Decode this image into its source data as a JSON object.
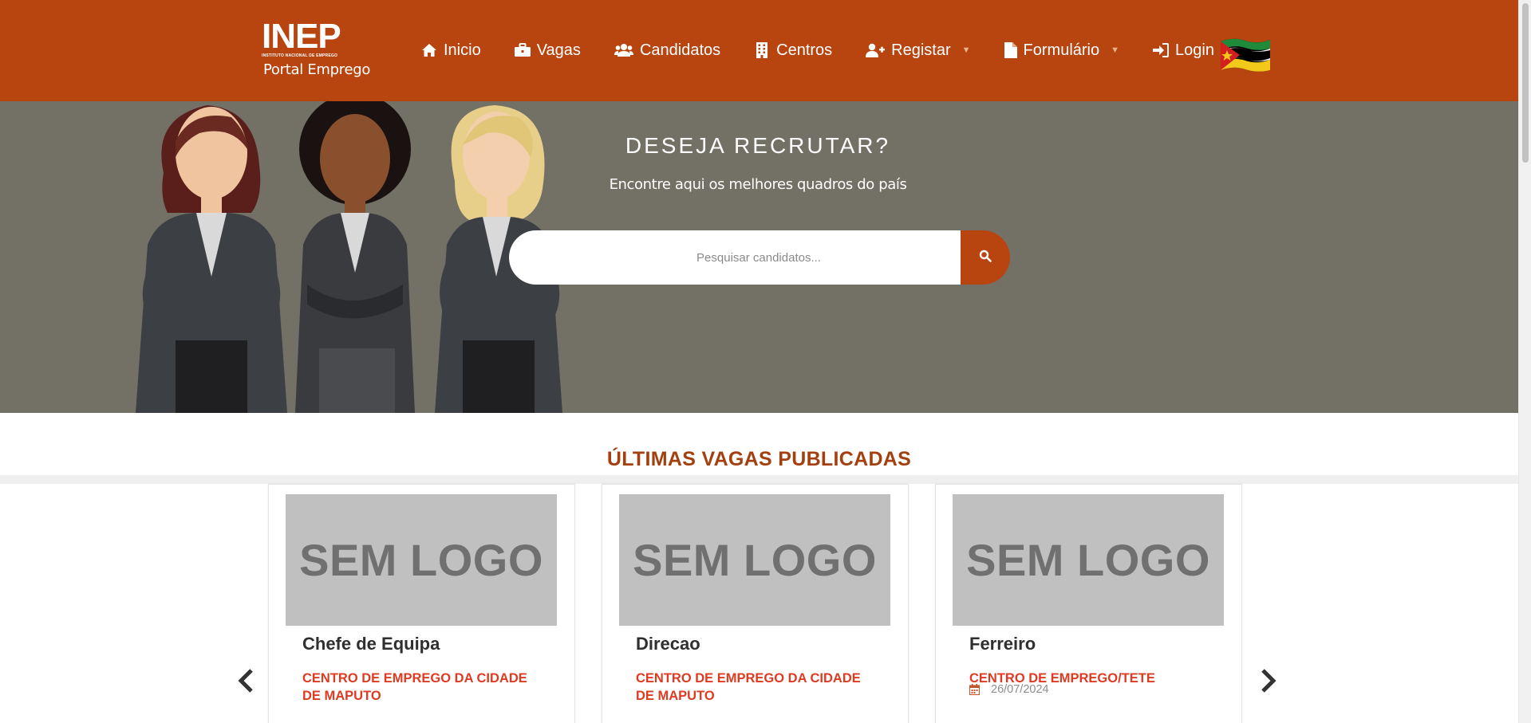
{
  "brand": {
    "logo_text": "INEP",
    "logo_small": "INSTITUTO NACIONAL DE EMPREGO",
    "logo_sub": "Portal Emprego"
  },
  "nav": [
    {
      "label": "Inicio",
      "icon": "home-icon"
    },
    {
      "label": "Vagas",
      "icon": "briefcase-icon"
    },
    {
      "label": "Candidatos",
      "icon": "users-icon"
    },
    {
      "label": "Centros",
      "icon": "building-icon"
    },
    {
      "label": "Registar",
      "icon": "user-plus-icon",
      "dropdown": true
    },
    {
      "label": "Formulário",
      "icon": "file-icon",
      "dropdown": true
    },
    {
      "label": "Login",
      "icon": "sign-in-icon"
    }
  ],
  "hero": {
    "title": "DESEJA RECRUTAR?",
    "subtitle": "Encontre aqui os melhores quadros do país",
    "search_placeholder": "Pesquisar candidatos..."
  },
  "section": {
    "title": "ÚLTIMAS VAGAS PUBLICADAS"
  },
  "cards": [
    {
      "logo_text": "SEM LOGO",
      "title": "Chefe de Equipa",
      "center": "CENTRO DE EMPREGO DA CIDADE DE MAPUTO",
      "date": ""
    },
    {
      "logo_text": "SEM LOGO",
      "title": "Direcao",
      "center": "CENTRO DE EMPREGO DA CIDADE DE MAPUTO",
      "date": ""
    },
    {
      "logo_text": "SEM LOGO",
      "title": "Ferreiro",
      "center": "CENTRO DE EMPREGO/TETE",
      "date": "26/07/2024"
    }
  ],
  "colors": {
    "brand": "#b8450f",
    "hero_bg": "#737066",
    "accent_red": "#de3b22",
    "section_title": "#a4400f"
  }
}
